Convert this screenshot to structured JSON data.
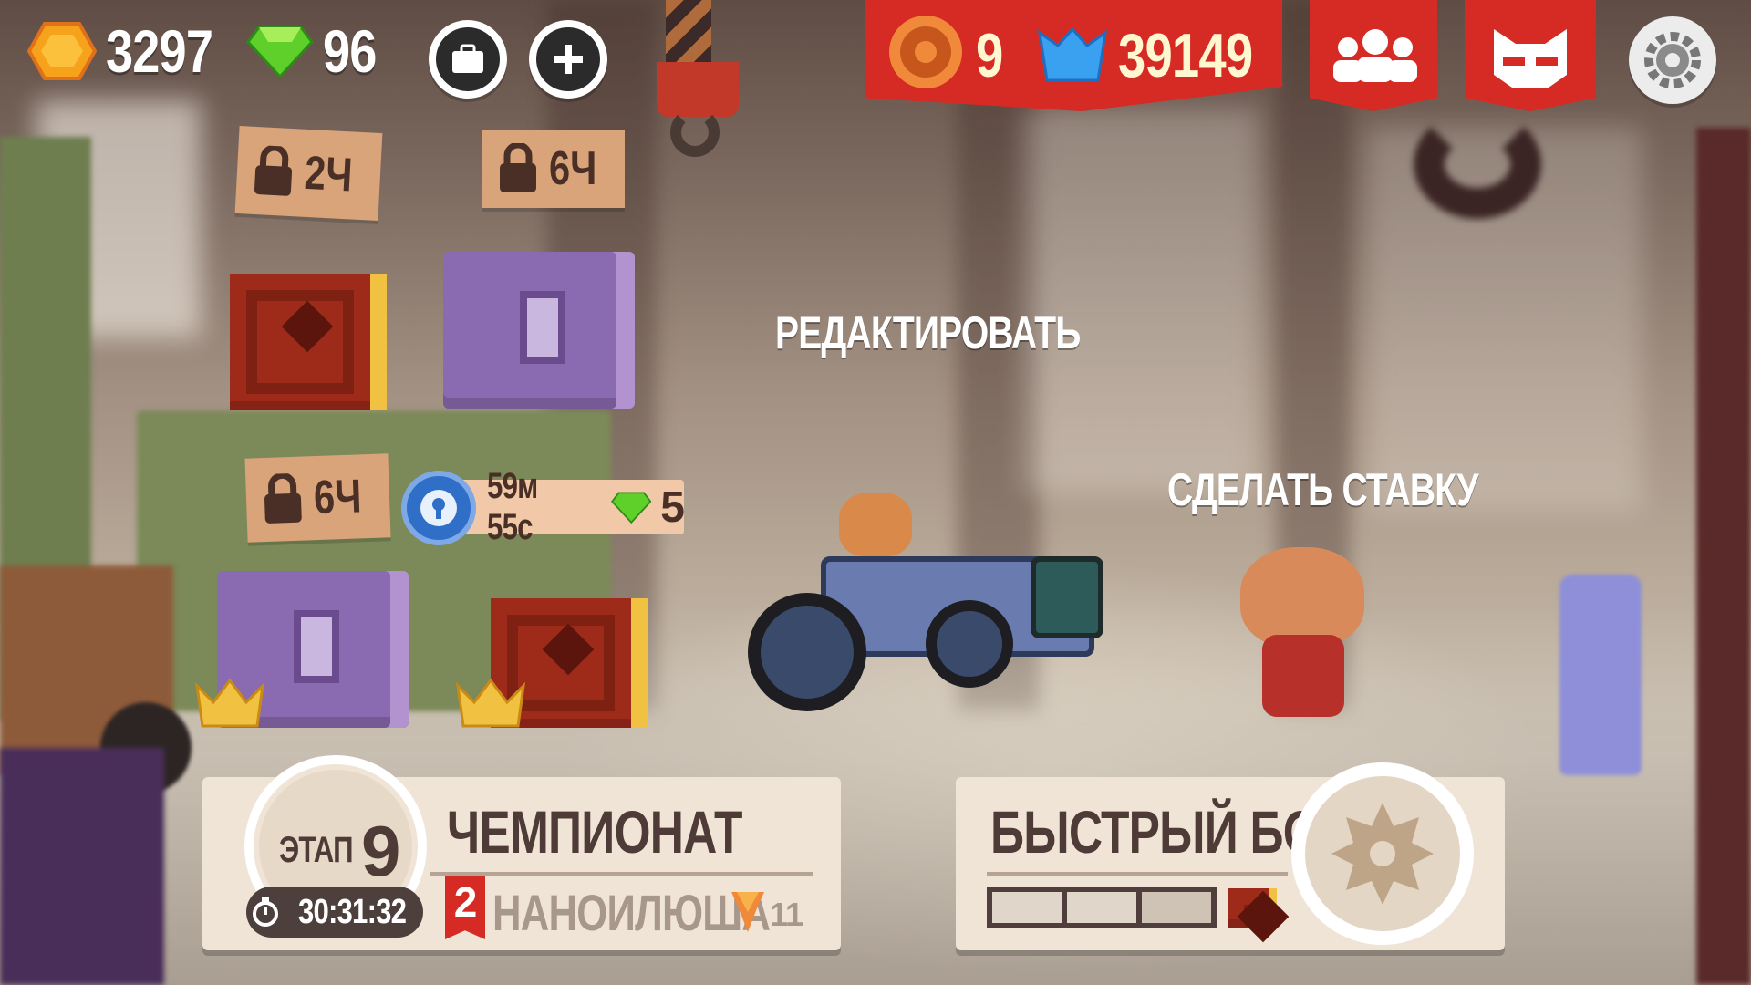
{
  "resources": {
    "coins": "3297",
    "gems": "96",
    "coin_icon": "hexagon-coin-icon",
    "gem_icon": "green-gem-icon"
  },
  "top_buttons": {
    "inventory": "inventory-box-icon",
    "add": "plus-icon"
  },
  "rank": {
    "level": "9",
    "trophies": "39149",
    "level_icon": "gear-medal-icon",
    "trophy_icon": "blue-cat-crown-icon"
  },
  "nav": {
    "team_icon": "team-people-icon",
    "profile_icon": "cat-mask-icon",
    "settings_icon": "gear-icon"
  },
  "chests": {
    "slot1_lock": "2Ч",
    "slot2_lock": "6Ч",
    "slot3_lock": "6Ч",
    "slot4_timer": "59м 55с",
    "slot4_gems": "5"
  },
  "actions": {
    "edit": "РЕДАКТИРОВАТЬ",
    "bet": "СДЕЛАТЬ СТАВКУ"
  },
  "championship": {
    "stage_label": "ЭТАП",
    "stage_number": "9",
    "title": "ЧЕМПИОНАТ",
    "timer": "30:31:32",
    "league_position": "2",
    "opponent": "НАНОИЛЮША",
    "league_points": "11"
  },
  "quick_battle": {
    "title": "БЫСТРЫЙ БОЙ",
    "progress_filled": 0,
    "progress_total": 3
  },
  "colors": {
    "banner_red": "#d62a24",
    "panel": "#efe4d6",
    "panel_text": "#4e3a36",
    "gold": "#f1c241"
  }
}
